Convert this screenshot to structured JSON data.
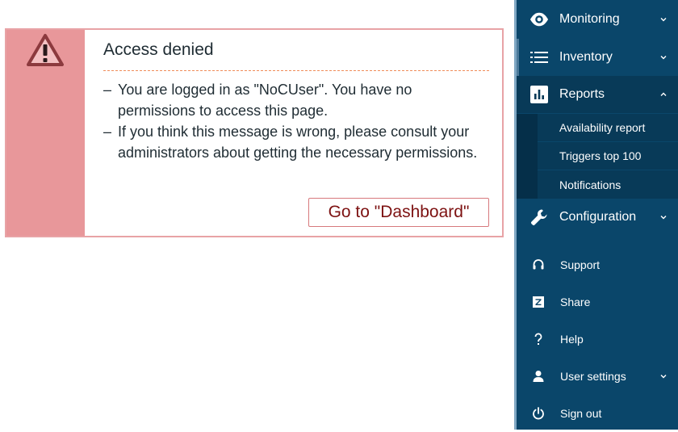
{
  "message": {
    "title": "Access denied",
    "lines": [
      "You are logged in as \"NoCUser\". You have no permissions to access this page.",
      "If you think this message is wrong, please consult your administrators about getting the necessary permissions."
    ],
    "dash": "–",
    "button_label": "Go to \"Dashboard\""
  },
  "sidebar": {
    "menu": [
      {
        "label": "Monitoring",
        "icon": "eye-icon"
      },
      {
        "label": "Inventory",
        "icon": "list-icon"
      },
      {
        "label": "Reports",
        "icon": "bar-chart-icon",
        "expanded": true
      },
      {
        "label": "Configuration",
        "icon": "wrench-icon"
      }
    ],
    "reports_submenu": [
      {
        "label": "Availability report"
      },
      {
        "label": "Triggers top 100"
      },
      {
        "label": "Notifications"
      }
    ],
    "bottom": [
      {
        "label": "Support",
        "icon": "headset-icon"
      },
      {
        "label": "Share",
        "icon": "share-z-icon"
      },
      {
        "label": "Help",
        "icon": "question-icon"
      },
      {
        "label": "User settings",
        "icon": "user-icon"
      },
      {
        "label": "Sign out",
        "icon": "power-icon"
      }
    ]
  },
  "colors": {
    "sidebar_bg": "#0a466a",
    "error_stripe": "#e8979a",
    "button_text": "#7d1212"
  }
}
